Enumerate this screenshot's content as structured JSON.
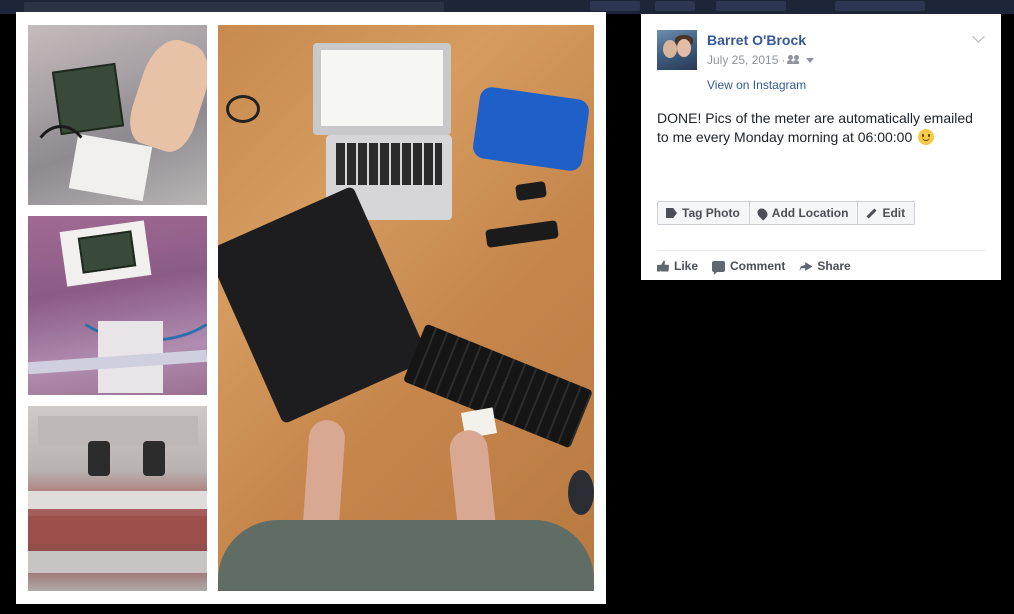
{
  "post": {
    "author": "Barret O'Brock",
    "date": "July 25, 2015",
    "date_sep": "·",
    "privacy_icon": "friends-icon",
    "view_on_instagram": "View on Instagram",
    "text": "DONE! Pics of the meter are automatically emailed to me every Monday morning at 06:00:00",
    "emoji_icon": "smile-icon"
  },
  "actions": {
    "tag_photo": "Tag Photo",
    "add_location": "Add Location",
    "edit": "Edit"
  },
  "feedback": {
    "like": "Like",
    "comment": "Comment",
    "share": "Share"
  },
  "colors": {
    "link": "#365899",
    "overlay": "#000000",
    "text": "#1d2129"
  }
}
